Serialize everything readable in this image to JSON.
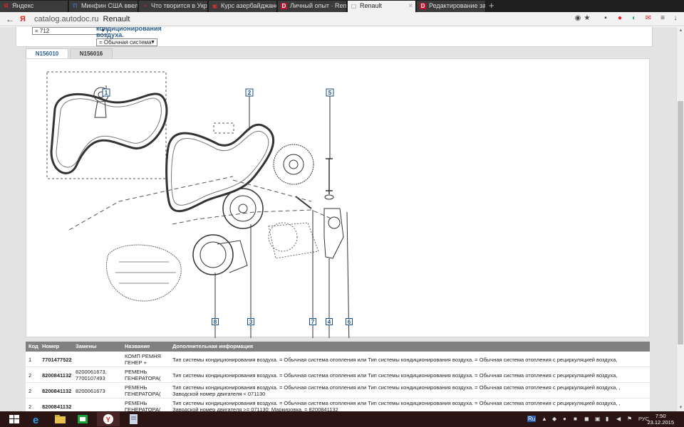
{
  "browser": {
    "tabs": [
      {
        "label": "Яндекс",
        "icon": "yandex-icon",
        "favicon_text": "Я",
        "favicon_color": "#e52620",
        "active": false
      },
      {
        "label": "Минфин США ввел са",
        "icon": "news-icon",
        "favicon_text": "П",
        "favicon_color": "#4a66b8",
        "active": false
      },
      {
        "label": "Что творится в Украи",
        "icon": "opera-icon",
        "favicon_text": "◔",
        "favicon_color": "#e22",
        "active": false
      },
      {
        "label": "Курс азербайджанско",
        "icon": "mail-icon",
        "favicon_text": "▣",
        "favicon_color": "#c33",
        "active": false
      },
      {
        "label": "Личный опыт · Renault",
        "icon": "drive2-icon",
        "favicon_text": "D",
        "favicon_color": "#c8102e",
        "active": false
      },
      {
        "label": "Renault",
        "icon": "page-icon",
        "favicon_text": "▢",
        "favicon_color": "#888",
        "active": true
      },
      {
        "label": "Редактирование запис",
        "icon": "drive2-icon",
        "favicon_text": "D",
        "favicon_color": "#c8102e",
        "active": false
      }
    ],
    "address": {
      "url": "catalog.autodoc.ru",
      "page_title": "Renault"
    }
  },
  "page": {
    "filters": {
      "left_select_value": "= 712",
      "label": "кондиционирования воздуха.",
      "right_select_value": "= Обычная система"
    },
    "subtabs": [
      {
        "label": "N156010",
        "active": true
      },
      {
        "label": "N156016",
        "active": false
      }
    ],
    "callouts": [
      "1",
      "2",
      "5",
      "8",
      "3",
      "7",
      "4",
      "6"
    ],
    "table": {
      "headers": [
        "Код",
        "Номер",
        "Замены",
        "Название",
        "Дополнительная информация"
      ],
      "rows": [
        {
          "code": "1",
          "number": "7701477522",
          "replacements": "",
          "name": "КОМП РЕМНЯ ГЕНЕР +",
          "info": "Тип системы кондиционирования воздуха. = Обычная система отопления или Тип системы кондиционирования воздуха. = Обычная система отопления с рециркуляцией воздуха,"
        },
        {
          "code": "2",
          "number": "8200841132",
          "replacements": "8200061673, 7700107493",
          "name": "РЕМЕНЬ ГЕНЕРАТОРА(",
          "info": "Тип системы кондиционирования воздуха. = Обычная система отопления или Тип системы кондиционирования воздуха. = Обычная система отопления с рециркуляцией воздуха,"
        },
        {
          "code": "2",
          "number": "8200841132",
          "replacements": "8200061673",
          "name": "РЕМЕНЬ ГЕНЕРАТОРА(",
          "info": "Тип системы кондиционирования воздуха. = Обычная система отопления или Тип системы кондиционирования воздуха. = Обычная система отопления с рециркуляцией воздуха, , Заводской номер двигателя < 071130"
        },
        {
          "code": "2",
          "number": "8200841132",
          "replacements": "",
          "name": "РЕМЕНЬ ГЕНЕРАТОРА(",
          "info": "Тип системы кондиционирования воздуха. = Обычная система отопления или Тип системы кондиционирования воздуха. = Обычная система отопления с рециркуляцией воздуха, , Заводской номер двигателя >= 071130; Маркировка. = 8200841132"
        }
      ]
    }
  },
  "taskbar": {
    "language": "РУС",
    "time": "7:50",
    "date": "23.12.2015",
    "tray_lang": "Ru"
  }
}
